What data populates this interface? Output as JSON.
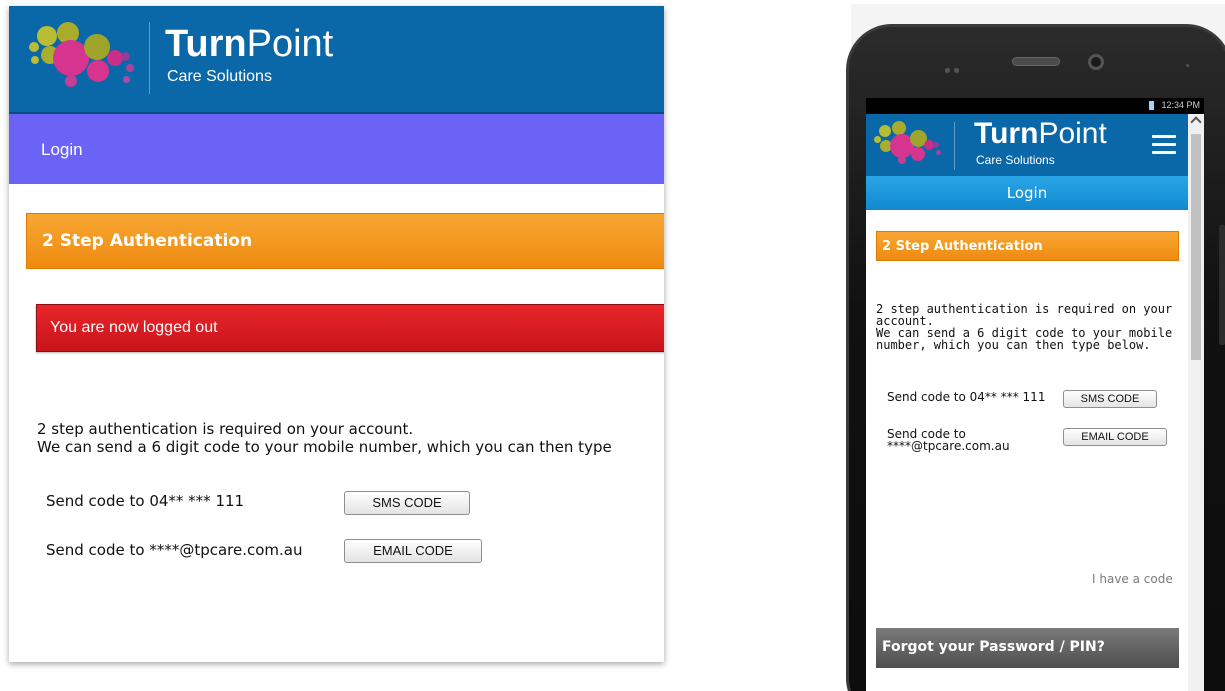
{
  "brand": {
    "name_bold": "Turn",
    "name_light": "Point",
    "tagline": "Care Solutions",
    "colors": {
      "header_blue": "#0a67a8",
      "dot_pink": "#d6348f",
      "dot_olive": "#9fa52b",
      "dot_purple": "#8d3f9e"
    }
  },
  "desktop": {
    "nav": {
      "login_label": "Login"
    },
    "panel_title": "2 Step Authentication",
    "alert_text": "You are now logged out",
    "intro_line1": "2 step authentication is required on your account.",
    "intro_line2": "We can send a 6 digit code to your mobile number, which you can then type",
    "sms_row": {
      "label": "Send code to 04** *** 111",
      "button": "SMS CODE"
    },
    "email_row": {
      "label": "Send code to ****@tpcare.com.au",
      "button": "EMAIL CODE"
    },
    "colors": {
      "nav_purple": "#6b63f5",
      "panel_orange": "#f39a1f",
      "alert_red": "#d71d22"
    }
  },
  "mobile": {
    "status": {
      "time": "12:34 PM",
      "battery_icon": "battery-icon"
    },
    "menu_icon": "hamburger-menu-icon",
    "nav": {
      "login_label": "Login"
    },
    "panel_title": "2 Step Authentication",
    "intro_line1": "2 step authentication is required on your",
    "intro_line2": "account.",
    "intro_line3": "We can send a 6 digit code to your mobile",
    "intro_line4": "number, which you can then type below.",
    "sms_row": {
      "label": "Send code to 04** *** 111",
      "button": "SMS CODE"
    },
    "email_row": {
      "label_line1": "Send code to",
      "label_line2": "****@tpcare.com.au",
      "button": "EMAIL CODE"
    },
    "have_code_link": "I have a code",
    "forgot_title": "Forgot your Password / PIN?",
    "colors": {
      "nav_blue": "#1a96da",
      "forgot_grey": "#5e5e5e"
    }
  }
}
